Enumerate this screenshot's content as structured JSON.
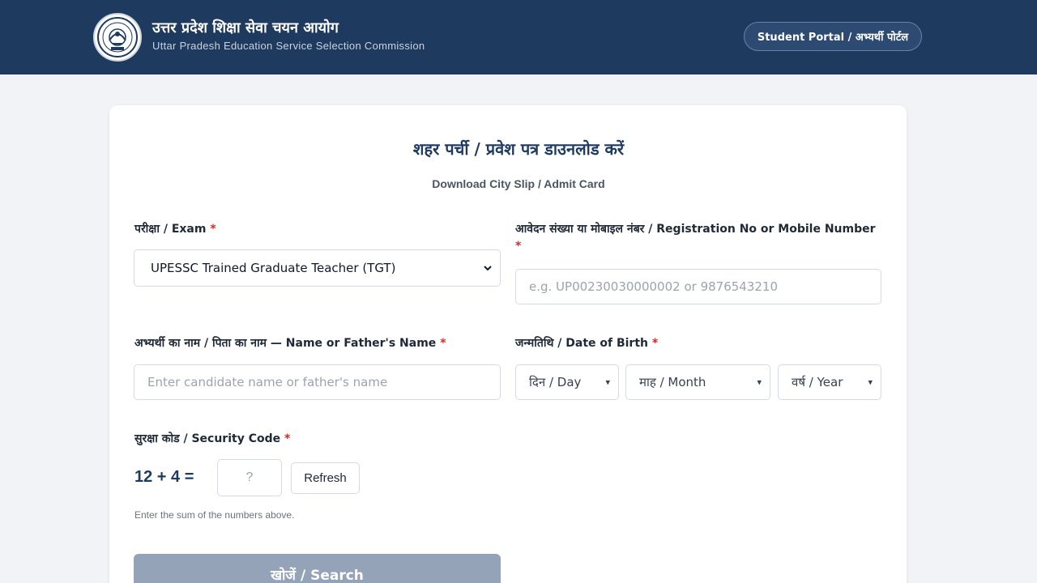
{
  "header": {
    "org_name_hi": "उत्तर प्रदेश शिक्षा सेवा चयन आयोग",
    "org_name_en": "Uttar Pradesh Education Service Selection Commission",
    "logo_icon": "upessc-emblem-icon",
    "portal_button": "Student Portal / अभ्यर्थी पोर्टल",
    "bg_color": "#1e3a5f"
  },
  "page": {
    "title_hi": "शहर पर्ची / प्रवेश पत्र डाउनलोड करें",
    "title_en": "Download City Slip / Admit Card"
  },
  "form": {
    "required_marker": "*",
    "exam": {
      "label": "परीक्षा / Exam",
      "selected": "UPESSC Trained Graduate Teacher (TGT)"
    },
    "registration": {
      "label": "आवेदन संख्या या मोबाइल नंबर / Registration No or Mobile Number",
      "placeholder": "e.g. UP00230030000002 or 9876543210"
    },
    "name": {
      "label": "अभ्यर्थी का नाम / पिता का नाम — Name or Father's Name",
      "placeholder": "Enter candidate name or father's name"
    },
    "dob": {
      "label": "जन्मतिथि / Date of Birth",
      "day": "दिन / Day",
      "month": "माह / Month",
      "year": "वर्ष / Year"
    },
    "security": {
      "label": "सुरक्षा कोड / Security Code",
      "question": "12 + 4 =",
      "answer_placeholder": "?",
      "refresh": "Refresh",
      "hint": "Enter the sum of the numbers above."
    },
    "search_button": "खोजें / Search",
    "accent_color": "#1e3a5f",
    "required_color": "#dc2626",
    "disabled_button_color": "#94a3b8"
  }
}
